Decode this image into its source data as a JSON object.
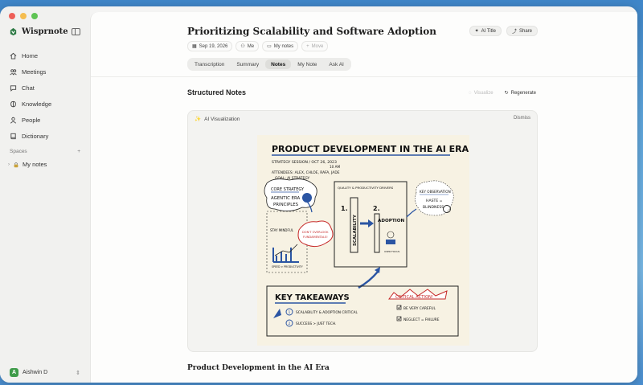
{
  "app": {
    "name": "Wisprnote"
  },
  "sidebar": {
    "items": [
      {
        "label": "Home",
        "icon": "home-icon"
      },
      {
        "label": "Meetings",
        "icon": "people-icon"
      },
      {
        "label": "Chat",
        "icon": "chat-icon"
      },
      {
        "label": "Knowledge",
        "icon": "brain-icon"
      },
      {
        "label": "People",
        "icon": "person-icon"
      },
      {
        "label": "Dictionary",
        "icon": "book-icon"
      }
    ],
    "spaces_label": "Spaces",
    "spaces_add": "+",
    "space_item": "My notes",
    "user_initial": "A",
    "user_name": "Aishwin D"
  },
  "note": {
    "title": "Prioritizing Scalability and Software Adoption",
    "ai_title_label": "AI Title",
    "share_label": "Share",
    "date": "Sep 19, 2026",
    "owner": "Me",
    "folder": "My notes",
    "move_label": "Move"
  },
  "tabs": [
    "Transcription",
    "Summary",
    "Notes",
    "My Note",
    "Ask AI"
  ],
  "active_tab": "Notes",
  "structured": {
    "title": "Structured Notes",
    "visualize_label": "Visualize",
    "regenerate_label": "Regenerate"
  },
  "visualization": {
    "label": "AI Visualization",
    "dismiss_label": "Dismiss",
    "sketch": {
      "heading": "PRODUCT DEVELOPMENT IN THE AI ERA",
      "session_line": "STRATEGY SESSION / OCT 26, 2023",
      "time_line": "10 AM",
      "attendees": "ATTENDEES: ALEX, CHLOE, RAFA, JADE",
      "goal": "GOAL: AI STRATEGY",
      "core_strategy": "CORE STRATEGY",
      "agentic_1": "AGENTIC ERA",
      "agentic_2": "PRINCIPLES",
      "stay_mindful": "STAY MINDFUL",
      "speed_label": "SPEED > PRODUCTIVITY",
      "dont_overlook_1": "DON'T OVERLOOK",
      "dont_overlook_2": "FUNDAMENTALS!",
      "drivers_title": "QUALITY & PRODUCTIVITY DRIVERS",
      "driver_1_num": "1.",
      "driver_1": "SCALABILITY",
      "driver_2_num": "2.",
      "driver_2": "ADOPTION",
      "user_focus": "USER FOCUS",
      "key_observation": "KEY OBSERVATION",
      "haste_1": "HASTE =",
      "haste_2": "BLINDNESS",
      "takeaways_title": "KEY TAKEAWAYS",
      "takeaway_1": "SCALABILITY & ADOPTION CRITICAL",
      "takeaway_2": "SUCCESS > JUST TECH.",
      "critical_title": "CRITICAL ACTION!",
      "critical_1": "BE VERY CAREFUL",
      "critical_2": "NEGLECT = FAILURE"
    }
  },
  "bottom_heading": "Product Development in the AI Era"
}
